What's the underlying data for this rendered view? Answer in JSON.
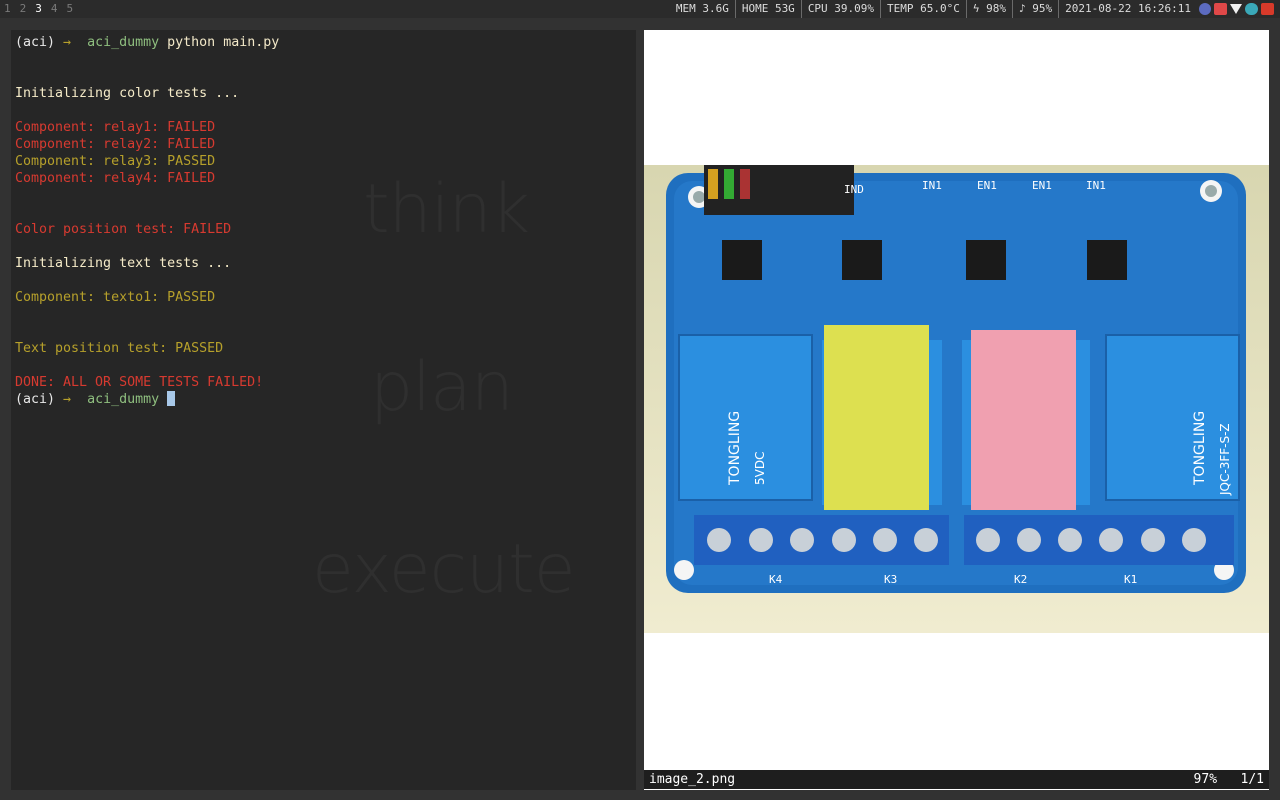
{
  "workspaces": [
    "1",
    "2",
    "3",
    "4",
    "5"
  ],
  "active_workspace": "3",
  "status": {
    "mem": "MEM 3.6G",
    "home": "HOME 53G",
    "cpu": "CPU 39.09%",
    "temp": "TEMP 65.0°C",
    "battery": "ϟ 98%",
    "volume": "♪ 95%",
    "datetime": "2021-08-22 16:26:11"
  },
  "tray_icons": [
    "discord-icon",
    "bug-icon",
    "wifi-icon",
    "cloud-icon",
    "stacks-icon"
  ],
  "terminal": {
    "watermark": [
      "think",
      "plan",
      "execute"
    ],
    "prompt_env": "(aci)",
    "prompt_arrow": "→",
    "prompt_dir": "aci_dummy",
    "command": "python main.py",
    "lines": [
      {
        "text": "",
        "style": "info"
      },
      {
        "text": "",
        "style": "info"
      },
      {
        "text": "Initializing color tests ...",
        "style": "info"
      },
      {
        "text": "",
        "style": "info"
      },
      {
        "text": "Component: relay1: FAILED",
        "style": "fail"
      },
      {
        "text": "Component: relay2: FAILED",
        "style": "fail"
      },
      {
        "text": "Component: relay3: PASSED",
        "style": "pass"
      },
      {
        "text": "Component: relay4: FAILED",
        "style": "fail"
      },
      {
        "text": "",
        "style": "info"
      },
      {
        "text": "",
        "style": "info"
      },
      {
        "text": "Color position test: FAILED",
        "style": "fail"
      },
      {
        "text": "",
        "style": "info"
      },
      {
        "text": "Initializing text tests ...",
        "style": "info"
      },
      {
        "text": "",
        "style": "info"
      },
      {
        "text": "Component: texto1: PASSED",
        "style": "pass"
      },
      {
        "text": "",
        "style": "info"
      },
      {
        "text": "",
        "style": "info"
      },
      {
        "text": "Text position test: PASSED",
        "style": "pass"
      },
      {
        "text": "",
        "style": "info"
      },
      {
        "text": "DONE: ALL OR SOME TESTS FAILED!",
        "style": "fail"
      }
    ]
  },
  "viewer": {
    "filename": "image_2.png",
    "zoom": "97%",
    "index": "1/1",
    "board_marks": [
      "IND",
      "IN1",
      "EN1",
      "EN1",
      "IN1",
      "K4",
      "K3",
      "K2",
      "K1"
    ],
    "relay_text": [
      "TONGLING",
      "5VDC",
      "JQC-3FF-S-Z"
    ]
  }
}
